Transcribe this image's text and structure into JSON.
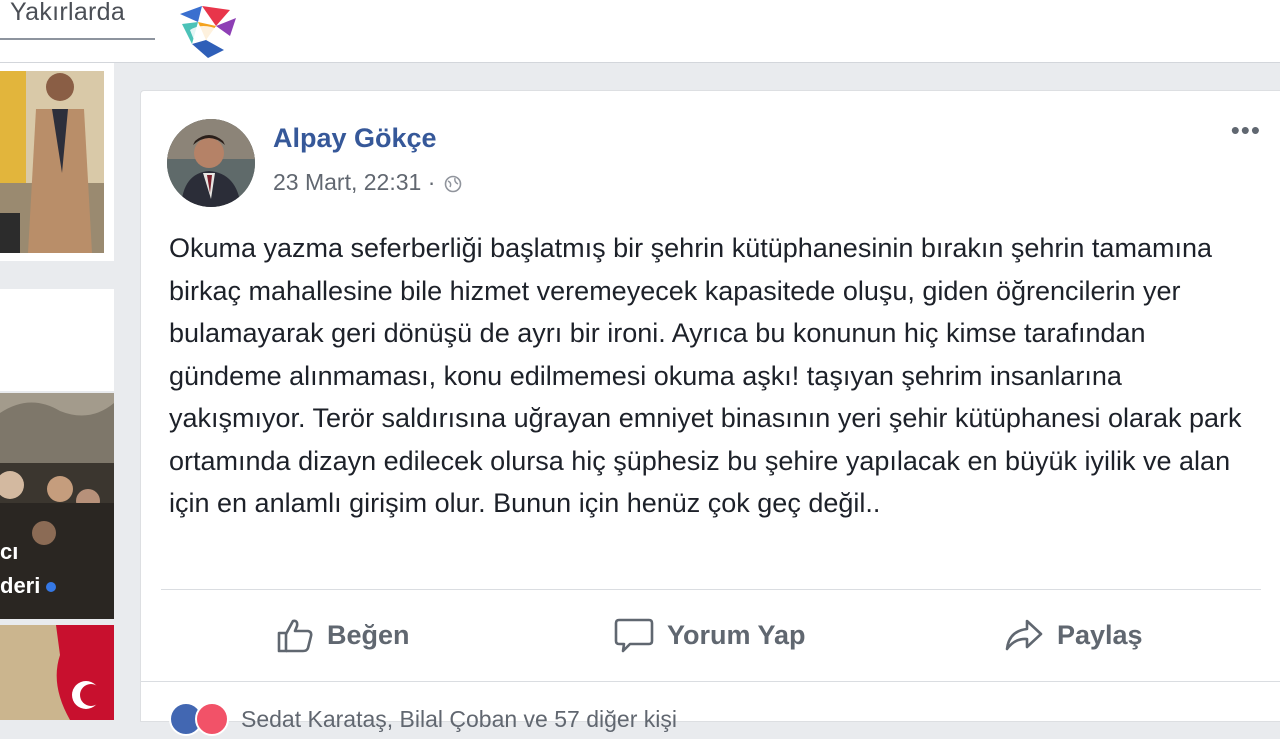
{
  "topbar": {
    "tab_label": "Yakırlarda"
  },
  "left_column": {
    "caption_line1": "cı",
    "caption_line2": "deri"
  },
  "post": {
    "author": "Alpay Gökçe",
    "timestamp": "23 Mart, 22:31 ·",
    "body": "Okuma yazma seferberliği başlatmış bir şehrin kütüphanesinin bırakın şehrin tamamına birkaç mahallesine bile hizmet veremeyecek kapasitede oluşu, giden öğrencilerin yer bulamayarak geri dönüşü de ayrı bir ironi. Ayrıca bu konunun hiç kimse tarafından gündeme alınmaması, konu edilmemesi okuma aşkı! taşıyan şehrim insanlarına yakışmıyor. Terör saldırısına uğrayan emniyet binasının yeri şehir kütüphanesi olarak park ortamında dizayn edilecek olursa hiç şüphesiz bu şehire yapılacak en büyük iyilik ve alan için en anlamlı girişim olur. Bunun için henüz çok geç değil..",
    "more_label": "•••",
    "actions": {
      "like": "Beğen",
      "comment": "Yorum Yap",
      "share": "Paylaş"
    },
    "reactions_text": "Sedat Karataş, Bilal Çoban ve 57 diğer kişi"
  },
  "colors": {
    "author_link": "#365899",
    "page_bg": "#e9ebee",
    "action_text": "#606770",
    "like_reaction": "#4267b2",
    "love_reaction": "#f25268"
  },
  "icons": [
    "brand-logo-icon",
    "globe-icon",
    "more-options-icon",
    "like-icon",
    "comment-icon",
    "share-icon",
    "like-reaction-icon",
    "love-reaction-icon"
  ]
}
